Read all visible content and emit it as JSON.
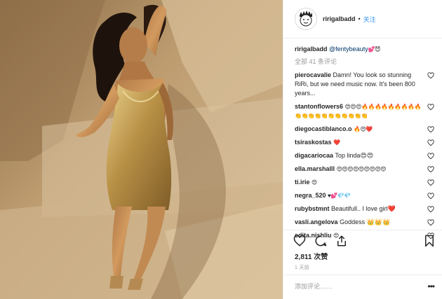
{
  "header": {
    "username": "ririgalbadd",
    "separator": "•",
    "follow": "关注"
  },
  "caption": {
    "username": "ririgalbadd",
    "mention": "@fentybeauty",
    "emoji": "💕😈"
  },
  "view_all_comments": "全部 41 条评论",
  "comments": [
    {
      "username": "pierocavalie",
      "text": "Damn! You look so stunning RiRi, but we need music now. It's been 800 years..."
    },
    {
      "username": "stantonflowers6",
      "text": "😍😍😍🔥🔥🔥🔥🔥🔥🔥🔥🔥👏👏👏👏👏👏👏👏👏👏👏"
    },
    {
      "username": "diegocastiblanco.o",
      "text": "🔥😍❤️"
    },
    {
      "username": "tsiraskostas",
      "text": "❤️"
    },
    {
      "username": "digacariocaa",
      "text": "Top linda😍😍"
    },
    {
      "username": "ella.marshalll",
      "text": "😍😍😍😍😍😍😍😍😍"
    },
    {
      "username": "ti.irie",
      "text": "😍"
    },
    {
      "username": "negra_520",
      "text": "♥💕💎💎"
    },
    {
      "username": "rubybstmnt",
      "text": "Beautifull.. I love girl❤️"
    },
    {
      "username": "vasli.angelova",
      "text": "Goddess 👑👑👑"
    },
    {
      "username": "edita.nishliu",
      "text": "😍"
    }
  ],
  "likes": "2,811 次赞",
  "time": "1 天前",
  "add_comment": {
    "placeholder": "添加评论……"
  },
  "more": "•••",
  "colors": {
    "link": "#3897f0",
    "mention": "#003569",
    "muted": "#999999",
    "border": "#efefef"
  },
  "icons": [
    "heart-icon",
    "comment-icon",
    "share-icon",
    "bookmark-icon",
    "more-icon"
  ]
}
